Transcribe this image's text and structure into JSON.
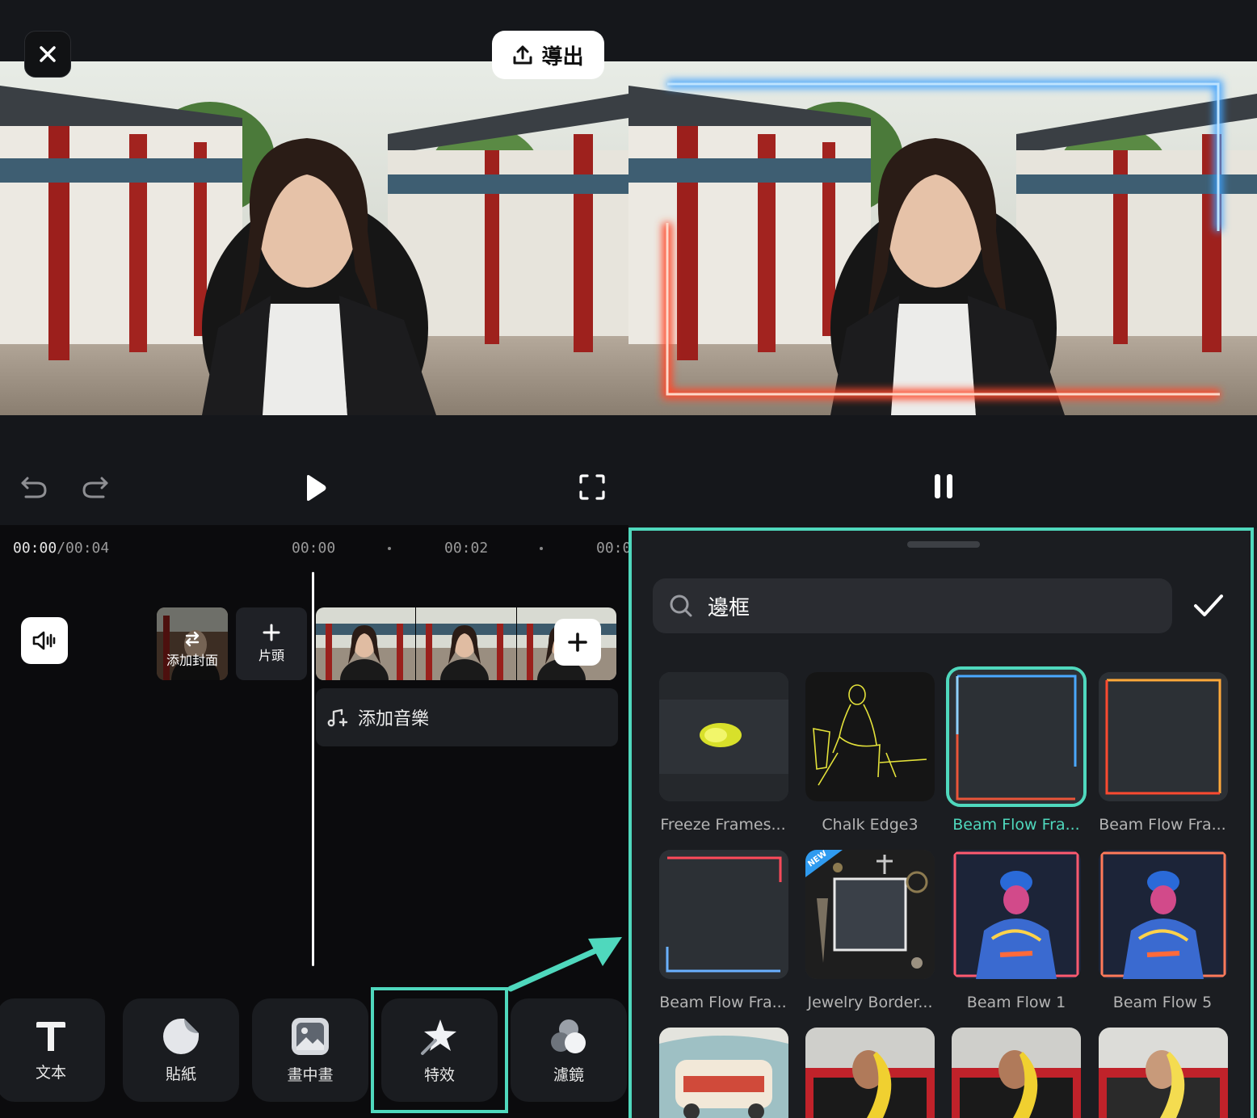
{
  "left": {
    "export_label": "導出",
    "timecode": {
      "current": "00:00",
      "total": "/00:04"
    },
    "ruler": [
      "00:00",
      "00:02",
      "00:0"
    ],
    "cover_label": "添加封面",
    "intro_label": "片頭",
    "music_label": "添加音樂",
    "tools": [
      {
        "label": "文本",
        "icon": "text-icon"
      },
      {
        "label": "貼紙",
        "icon": "sticker-icon"
      },
      {
        "label": "畫中畫",
        "icon": "picture-in-picture-icon"
      },
      {
        "label": "特效",
        "icon": "effects-icon"
      },
      {
        "label": "濾鏡",
        "icon": "filter-icon"
      }
    ]
  },
  "right": {
    "search_value": "邊框",
    "effects": [
      {
        "label": "Freeze Frames...",
        "selected": false
      },
      {
        "label": "Chalk Edge3",
        "selected": false
      },
      {
        "label": "Beam Flow Fra...",
        "selected": true
      },
      {
        "label": "Beam Flow Fra...",
        "selected": false
      },
      {
        "label": "Beam Flow Fra...",
        "selected": false
      },
      {
        "label": "Jewelry Border...",
        "selected": false
      },
      {
        "label": "Beam Flow 1",
        "selected": false
      },
      {
        "label": "Beam Flow 5",
        "selected": false
      }
    ],
    "new_badge": "NEW"
  },
  "colors": {
    "accent": "#4fd8bd",
    "panel": "#15171b",
    "sheet": "#1b1d21"
  }
}
